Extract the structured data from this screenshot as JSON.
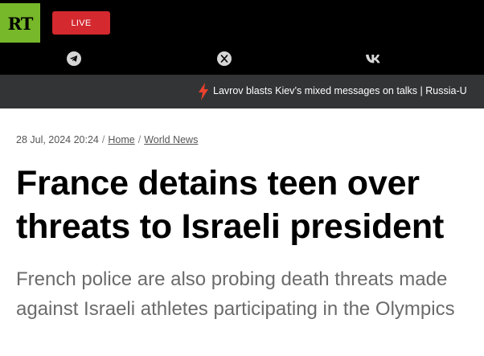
{
  "header": {
    "logo_text": "RT",
    "live_label": "LIVE",
    "social_icons": [
      "telegram-icon",
      "x-icon",
      "vk-icon"
    ]
  },
  "ticker": {
    "icon": "lightning-icon",
    "text": "Lavrov blasts Kiev’s mixed messages on talks | Russia-U"
  },
  "article": {
    "timestamp": "28 Jul, 2024 20:24",
    "separator": "/",
    "breadcrumbs": [
      "Home",
      "World News"
    ],
    "title": "France detains teen over threats to Israeli president",
    "summary": "French police are also probing death threats made against Israeli athletes participating in the Olympics"
  },
  "colors": {
    "header_bg": "#000000",
    "logo_green": "#77b82a",
    "live_red": "#d3292f",
    "ticker_bg": "#333436",
    "bolt_red": "#e8412d",
    "summary_gray": "#6b6b6b"
  }
}
